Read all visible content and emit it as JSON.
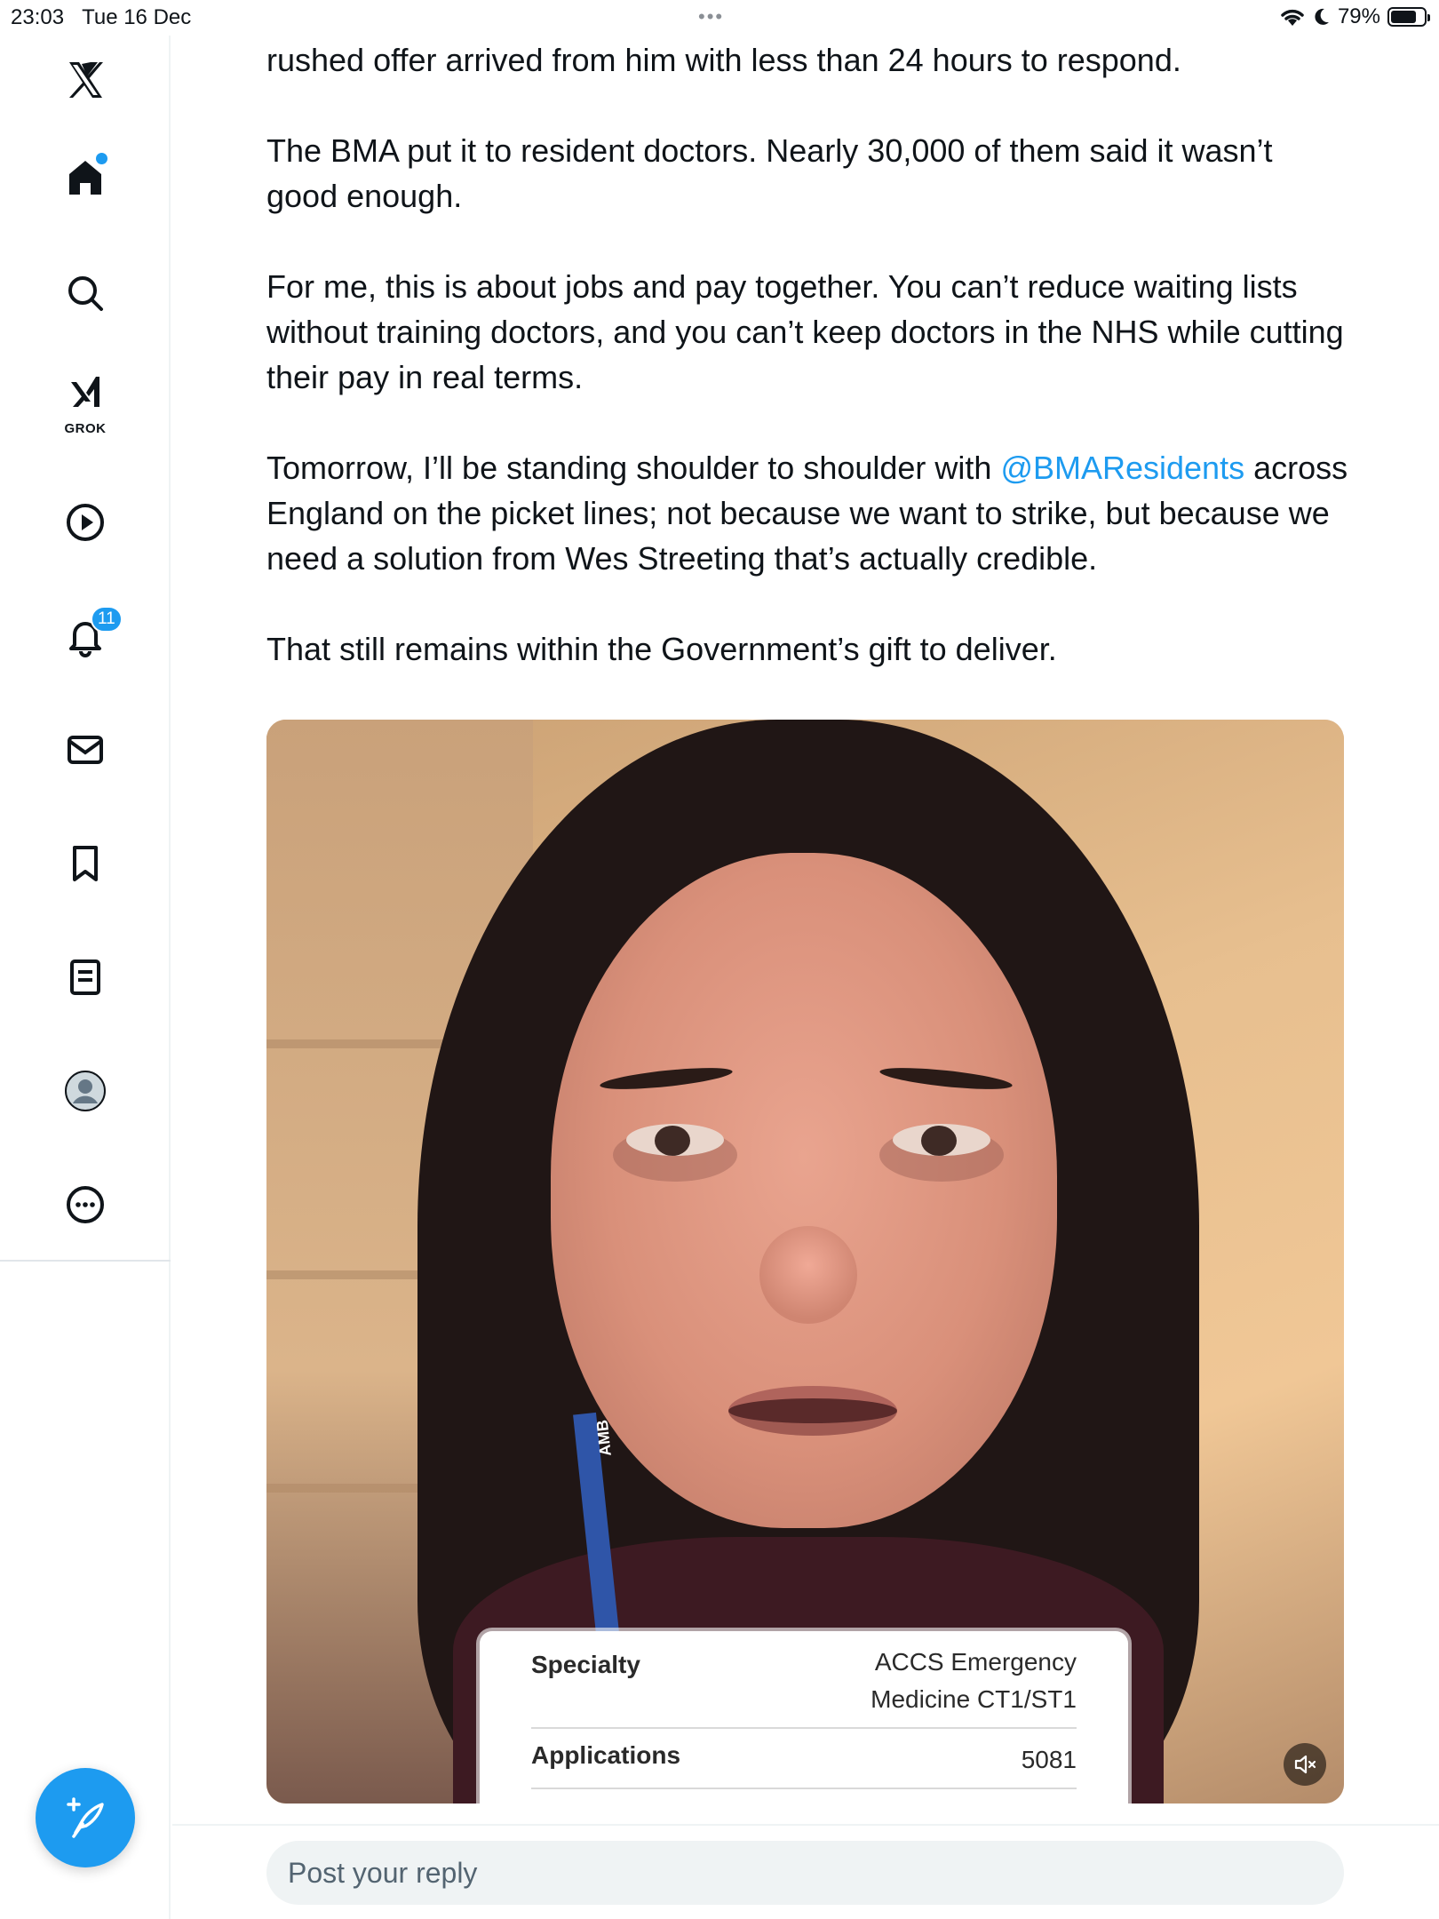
{
  "status_bar": {
    "time": "23:03",
    "date": "Tue 16 Dec",
    "dots": "•••",
    "battery_percent": "79%",
    "battery_level": 0.79
  },
  "sidebar": {
    "items": [
      {
        "name": "x-logo-icon"
      },
      {
        "name": "home-icon",
        "has_dot": true
      },
      {
        "name": "search-icon"
      },
      {
        "name": "grok-icon",
        "label": "GROK"
      },
      {
        "name": "video-play-icon"
      },
      {
        "name": "notifications-bell-icon",
        "badge": "11"
      },
      {
        "name": "messages-mail-icon"
      },
      {
        "name": "bookmark-icon"
      },
      {
        "name": "lists-icon"
      },
      {
        "name": "profile-avatar-icon"
      },
      {
        "name": "more-icon"
      }
    ],
    "compose_icon": "compose-feather-icon"
  },
  "post": {
    "para1": "rushed offer arrived from him with less than 24 hours to respond.",
    "para2": "The BMA put it to resident doctors. Nearly 30,000 of them said it wasn’t good enough.",
    "para3": "For me, this is about jobs and pay together. You can’t reduce waiting lists without training doctors, and you can’t keep doctors in the NHS while cutting their pay in real terms.",
    "para4_before": "Tomorrow, I’ll be standing shoulder to shoulder with ",
    "para4_mention": "@BMAResidents",
    "para4_after": " across England on the picket lines; not because we want to strike, but because we need a solution from Wes Streeting that’s actually credible.",
    "para5": "That still remains within the Government’s gift to deliver."
  },
  "video": {
    "lanyard_text": "AMB",
    "card": {
      "specialty_label": "Specialty",
      "specialty_value": "ACCS Emergency Medicine CT1/ST1",
      "applications_label": "Applications",
      "applications_value": "5081"
    },
    "mute_icon": "muted-speaker-icon"
  },
  "reply": {
    "placeholder": "Post your reply"
  },
  "colors": {
    "accent": "#1d9bf0",
    "text": "#0f1419",
    "muted": "#536471"
  }
}
